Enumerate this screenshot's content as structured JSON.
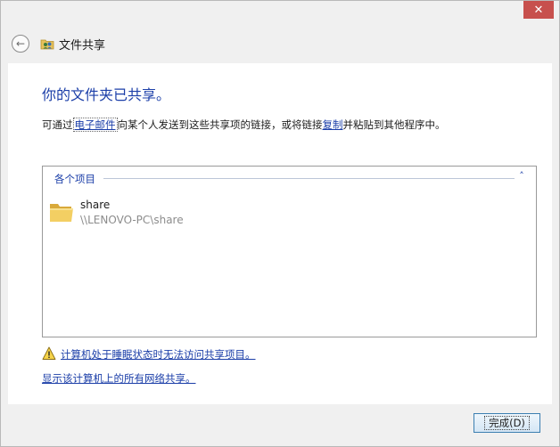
{
  "window": {
    "title": "文件共享",
    "close_icon": "close-icon",
    "close_label": "✕",
    "back_icon": "back-arrow-icon",
    "back_label": "←"
  },
  "main": {
    "heading": "你的文件夹已共享。",
    "desc_prefix": "可通过",
    "desc_email_link": "电子邮件",
    "desc_middle": "向某个人发送到这些共享项的链接，或将链接",
    "desc_copy_link": "复制",
    "desc_suffix": "并粘贴到其他程序中。"
  },
  "items_group": {
    "label": "各个项目",
    "chevron": "˄",
    "items": [
      {
        "name": "share",
        "path": "\\\\LENOVO-PC\\share",
        "icon": "folder-icon"
      }
    ]
  },
  "links": {
    "sleep_warning": "计算机处于睡眠状态时无法访问共享项目。",
    "show_all_shares": "显示该计算机上的所有网络共享。"
  },
  "footer": {
    "done_label": "完成(D)"
  },
  "colors": {
    "link": "#1b3ea8",
    "close_button": "#c7504d",
    "window_bg": "#f0f0f0",
    "content_bg": "#ffffff"
  }
}
